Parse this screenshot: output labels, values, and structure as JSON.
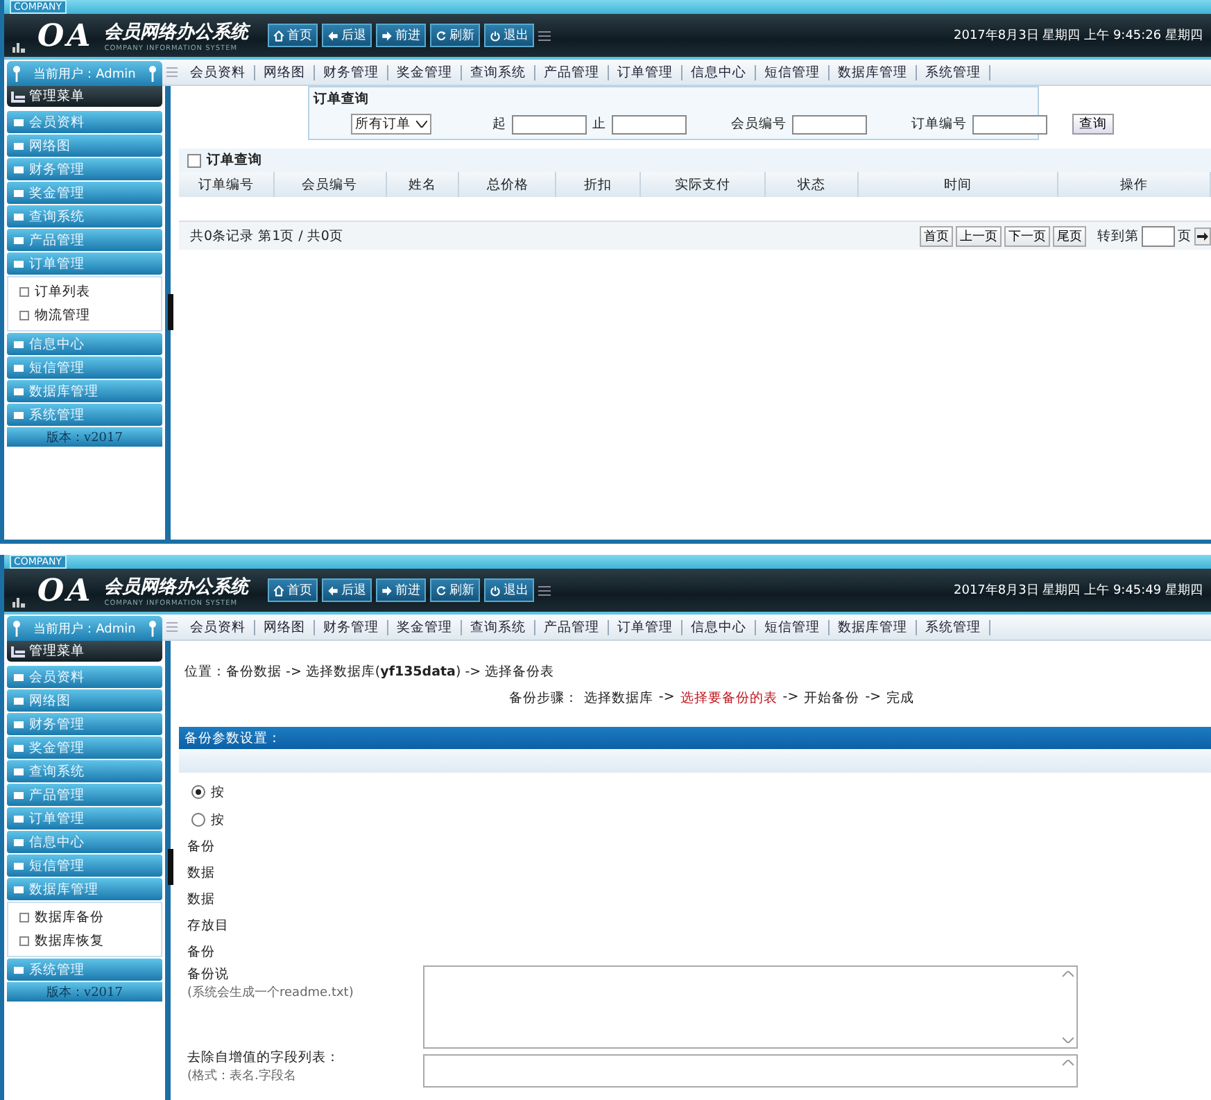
{
  "screens": [
    {
      "kind": "orders",
      "brand": {
        "tag": "COMPANY",
        "logo": "OA",
        "title": "会员网络办公系统",
        "subtitle": "COMPANY INFORMATION SYSTEM"
      },
      "toolbar": [
        "首页",
        "后退",
        "前进",
        "刷新",
        "退出"
      ],
      "clock": "2017年8月3日 星期四 上午 9:45:26 星期四",
      "user": "当前用户：Admin",
      "nav": [
        "会员资料",
        "网络图",
        "财务管理",
        "奖金管理",
        "查询系统",
        "产品管理",
        "订单管理",
        "信息中心",
        "短信管理",
        "数据库管理",
        "系统管理"
      ],
      "sidebar": {
        "title": "管理菜单",
        "items": [
          {
            "label": "会员资料"
          },
          {
            "label": "网络图"
          },
          {
            "label": "财务管理"
          },
          {
            "label": "奖金管理"
          },
          {
            "label": "查询系统"
          },
          {
            "label": "产品管理"
          },
          {
            "label": "订单管理",
            "children": [
              {
                "label": "订单列表"
              },
              {
                "label": "物流管理"
              }
            ]
          },
          {
            "label": "信息中心"
          },
          {
            "label": "短信管理"
          },
          {
            "label": "数据库管理"
          },
          {
            "label": "系统管理"
          }
        ],
        "version": "版本：v2017"
      },
      "query": {
        "title": "订单查询",
        "select": "所有订单",
        "fields": [
          {
            "label": "起"
          },
          {
            "label": "止"
          },
          {
            "label": "会员编号"
          },
          {
            "label": "订单编号"
          }
        ],
        "button": "查询"
      },
      "table": {
        "title": "订单查询",
        "checked": false,
        "columns": [
          "订单编号",
          "会员编号",
          "姓名",
          "总价格",
          "折扣",
          "实际支付",
          "状态",
          "时间",
          "操作"
        ],
        "footer": "共0条记录 第1页 / 共0页",
        "pager": [
          "首页",
          "上一页",
          "下一页",
          "尾页"
        ],
        "goto_prefix": "转到第",
        "goto_suffix": "页"
      }
    },
    {
      "kind": "backup",
      "brand": {
        "tag": "COMPANY",
        "logo": "OA",
        "title": "会员网络办公系统",
        "subtitle": "COMPANY INFORMATION SYSTEM"
      },
      "toolbar": [
        "首页",
        "后退",
        "前进",
        "刷新",
        "退出"
      ],
      "clock": "2017年8月3日 星期四 上午 9:45:49 星期四",
      "user": "当前用户：Admin",
      "nav": [
        "会员资料",
        "网络图",
        "财务管理",
        "奖金管理",
        "查询系统",
        "产品管理",
        "订单管理",
        "信息中心",
        "短信管理",
        "数据库管理",
        "系统管理"
      ],
      "sidebar": {
        "title": "管理菜单",
        "items": [
          {
            "label": "会员资料"
          },
          {
            "label": "网络图"
          },
          {
            "label": "财务管理"
          },
          {
            "label": "奖金管理"
          },
          {
            "label": "查询系统"
          },
          {
            "label": "产品管理"
          },
          {
            "label": "订单管理"
          },
          {
            "label": "信息中心"
          },
          {
            "label": "短信管理"
          },
          {
            "label": "数据库管理",
            "children": [
              {
                "label": "数据库备份"
              },
              {
                "label": "数据库恢复"
              }
            ]
          },
          {
            "label": "系统管理"
          }
        ],
        "version": "版本：v2017"
      },
      "breadcrumb": "位置：备份数据 -> 选择数据库(**yf135data**) -> 选择备份表",
      "steps": {
        "prefix": "备份步骤：",
        "separator": "->",
        "items": [
          {
            "label": "选择数据库",
            "selected": false
          },
          {
            "label": "选择要备份的表",
            "selected": true
          },
          {
            "label": "开始备份",
            "selected": false
          },
          {
            "label": "完成",
            "selected": false
          }
        ]
      },
      "panel": {
        "title": "备份参数设置：",
        "options": [
          {
            "label": "按",
            "selected": true
          },
          {
            "label": "按",
            "selected": false
          }
        ],
        "labels": [
          "备份",
          "数据",
          "数据",
          "存放目",
          "备份"
        ],
        "notes": [
          {
            "label": "备份说",
            "hint": "(系统会生成一个readme.txt)"
          },
          {
            "label": "去除自增值的字段列表：",
            "hint": "(格式：表名.字段名"
          }
        ]
      }
    }
  ]
}
